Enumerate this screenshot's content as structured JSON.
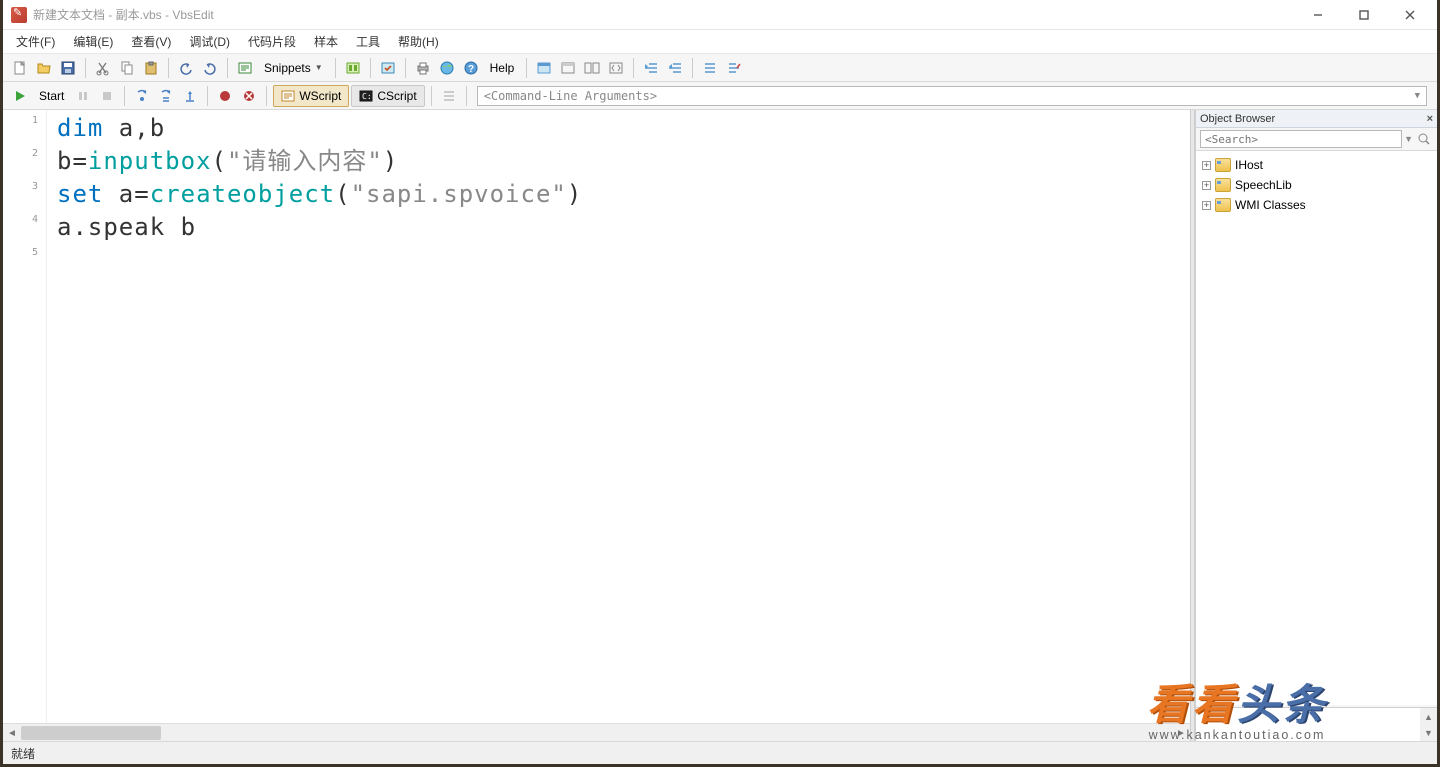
{
  "title": "新建文本文档 - 副本.vbs - VbsEdit",
  "menu": {
    "file": "文件(F)",
    "edit": "编辑(E)",
    "view": "查看(V)",
    "debug": "调试(D)",
    "snippets": "代码片段",
    "samples": "样本",
    "tools": "工具",
    "help": "帮助(H)"
  },
  "toolbar1": {
    "snippets": "Snippets",
    "help": "Help"
  },
  "toolbar2": {
    "start": "Start",
    "wscript": "WScript",
    "cscript": "CScript",
    "cmdline_placeholder": "<Command-Line Arguments>"
  },
  "code": {
    "lines": [
      {
        "n": "1",
        "tokens": [
          [
            "dim",
            "kw"
          ],
          [
            " a,b",
            "op"
          ]
        ]
      },
      {
        "n": "2",
        "tokens": [
          [
            "b=",
            "op"
          ],
          [
            "inputbox",
            "fn"
          ],
          [
            "(",
            "op"
          ],
          [
            "\"请输入内容\"",
            "str"
          ],
          [
            ")",
            "op"
          ]
        ]
      },
      {
        "n": "3",
        "tokens": [
          [
            "set",
            "kw"
          ],
          [
            " a=",
            "op"
          ],
          [
            "createobject",
            "fn"
          ],
          [
            "(",
            "op"
          ],
          [
            "\"sapi.spvoice\"",
            "str"
          ],
          [
            ")",
            "op"
          ]
        ]
      },
      {
        "n": "4",
        "tokens": [
          [
            "a.speak b",
            "op"
          ]
        ]
      },
      {
        "n": "5",
        "tokens": []
      }
    ]
  },
  "object_browser": {
    "title": "Object Browser",
    "search_placeholder": "<Search>",
    "items": [
      "IHost",
      "SpeechLib",
      "WMI Classes"
    ]
  },
  "status": "就绪",
  "watermark": {
    "main_a": "看看",
    "main_b": "头条",
    "sub": "www.kankantoutiao.com"
  }
}
